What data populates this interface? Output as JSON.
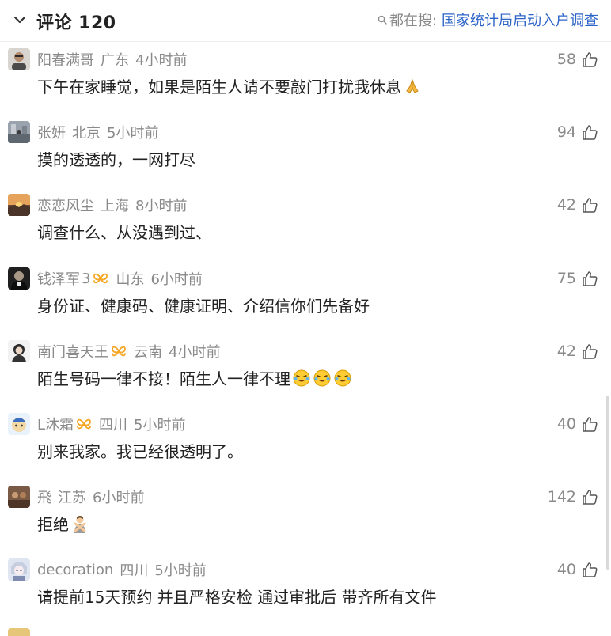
{
  "header": {
    "title": "评论 120",
    "trending_prefix": "都在搜:",
    "trending_query": "国家统计局启动入户调查"
  },
  "comments": [
    {
      "avatar": "avatar-man-photo",
      "username": "阳春满哥",
      "location": "广东",
      "time": "4小时前",
      "likes": "58",
      "text": "下午在家睡觉，如果是陌生人请不要敲门打扰我休息",
      "emoji": "folded-hands-icon"
    },
    {
      "avatar": "avatar-street-photo",
      "username": "张妍",
      "location": "北京",
      "time": "5小时前",
      "likes": "94",
      "text": "摸的透透的，一网打尽"
    },
    {
      "avatar": "avatar-sunset-photo",
      "username": "恋恋风尘",
      "location": "上海",
      "time": "8小时前",
      "likes": "42",
      "text": "调查什么、从没遇到过、"
    },
    {
      "avatar": "avatar-dark-portrait",
      "username": "钱泽军",
      "level": "3",
      "fan_badge": "fan-badge-icon",
      "location": "山东",
      "time": "6小时前",
      "likes": "75",
      "text": "身份证、健康码、健康证明、介绍信你们先备好"
    },
    {
      "avatar": "avatar-white-portrait",
      "username": "南门喜天王",
      "fan_badge": "fan-badge-icon",
      "location": "云南",
      "time": "4小时前",
      "likes": "42",
      "text": "陌生号码一律不接！陌生人一律不理",
      "emoji": "laughing-crying-icon x3"
    },
    {
      "avatar": "avatar-cartoon",
      "username": "L沐霜",
      "fan_badge": "fan-badge-icon",
      "location": "四川",
      "time": "5小时前",
      "likes": "40",
      "text": "别来我家。我已经很透明了。"
    },
    {
      "avatar": "avatar-brown-photo",
      "username": "飛",
      "location": "江苏",
      "time": "6小时前",
      "likes": "142",
      "text": "拒绝",
      "emoji": "person-gesturing-no-icon"
    },
    {
      "avatar": "avatar-anime",
      "username": "decoration",
      "location": "四川",
      "time": "5小时前",
      "likes": "40",
      "text": "请提前15天预约 并且严格安检 通过审批后 带齐所有文件"
    }
  ],
  "colors": {
    "meta_gray": "#8a8a8a",
    "link_blue": "#2c64c8",
    "badge_orange": "#f5a623",
    "text": "#222222"
  }
}
